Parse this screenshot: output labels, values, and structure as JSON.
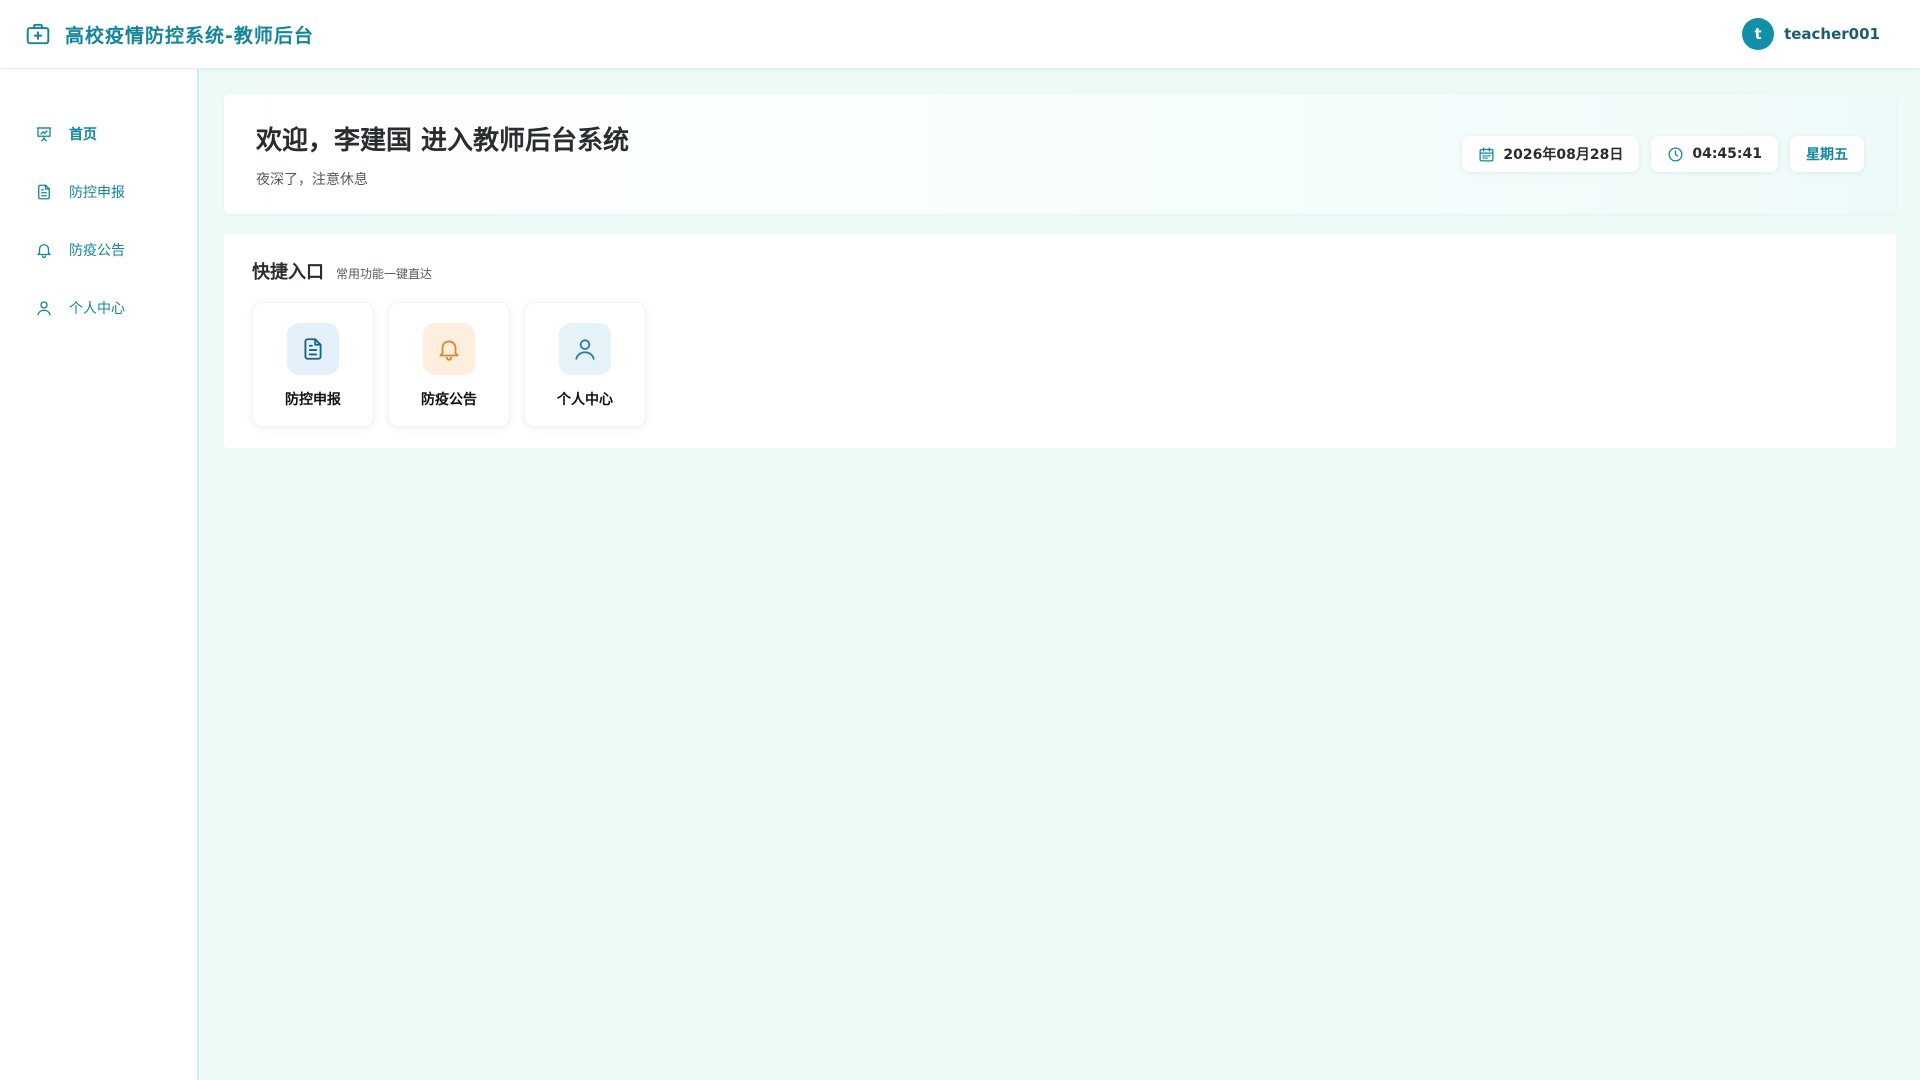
{
  "header": {
    "title": "高校疫情防控系统-教师后台",
    "user": {
      "initial": "t",
      "name": "teacher001"
    },
    "brand_icon": "medical-kit-icon"
  },
  "sidebar": {
    "items": [
      {
        "label": "首页",
        "icon": "presentation-icon",
        "active": true
      },
      {
        "label": "防控申报",
        "icon": "document-icon",
        "active": false
      },
      {
        "label": "防疫公告",
        "icon": "bell-icon",
        "active": false
      },
      {
        "label": "个人中心",
        "icon": "user-icon",
        "active": false
      }
    ]
  },
  "welcome": {
    "title": "欢迎，李建国 进入教师后台系统",
    "subtitle": "夜深了，注意休息",
    "date": "2026年08月28日",
    "time": "04:45:41",
    "weekday": "星期五"
  },
  "quick": {
    "title": "快捷入口",
    "subtitle": "常用功能一键直达",
    "cards": [
      {
        "label": "防控申报",
        "icon": "document-icon",
        "color": "#1d5e8a"
      },
      {
        "label": "防疫公告",
        "icon": "bell-icon",
        "color": "#e0872e"
      },
      {
        "label": "个人中心",
        "icon": "user-icon",
        "color": "#2c7aa0"
      }
    ]
  },
  "colors": {
    "accent": "#14869b",
    "background": "#eefaf8"
  }
}
